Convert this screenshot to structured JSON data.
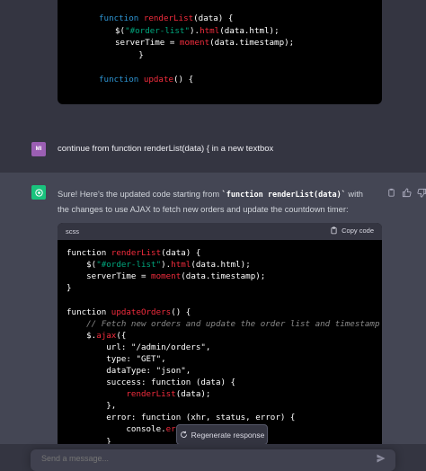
{
  "top_code_lines": [
    [
      "        ",
      "function",
      " ",
      "renderList",
      "(data) {"
    ],
    [
      "            $(",
      "\"#order-list\"",
      ").",
      "html",
      "(data.html);"
    ],
    [
      "            serverTime = ",
      "moment",
      "(data.timestamp);"
    ],
    [
      "        }"
    ],
    [
      "        ",
      "function",
      " ",
      "update",
      "() {"
    ]
  ],
  "user_message": {
    "avatar_initials": "MI",
    "text": "continue from function renderList(data) { in a new textbox"
  },
  "assistant_message": {
    "text_pre": "Sure! Here's the updated code starting from ",
    "inline_code": "`function renderList(data)`",
    "text_post": " with the changes to use AJAX to fetch new orders and update the countdown timer:"
  },
  "code_block": {
    "language": "scss",
    "copy_label": "Copy code"
  },
  "code_lines": {
    "l1a": "function ",
    "l1b": "renderList",
    "l1c": "(data) {",
    "l2a": "    $(",
    "l2b": "\"#order-list\"",
    "l2c": ").",
    "l2d": "html",
    "l2e": "(data.html);",
    "l3a": "    serverTime = ",
    "l3b": "moment",
    "l3c": "(data.timestamp);",
    "l4": "}",
    "l6a": "function ",
    "l6b": "updateOrders",
    "l6c": "() {",
    "l7": "    // Fetch new orders and update the order list and timestamp",
    "l8a": "    $.",
    "l8b": "ajax",
    "l8c": "({",
    "l9": "        url: \"/admin/orders\",",
    "l10": "        type: \"GET\",",
    "l11": "        dataType: \"json\",",
    "l12": "        success: function (data) {",
    "l13a": "            ",
    "l13b": "renderList",
    "l13c": "(data);",
    "l14": "        },",
    "l15": "        error: function (xhr, status, error) {",
    "l16a": "            console.",
    "l16b": "error",
    "l16c": "(e",
    "l17": "        }"
  },
  "regenerate_label": "Regenerate response",
  "input": {
    "placeholder": "Send a message..."
  }
}
